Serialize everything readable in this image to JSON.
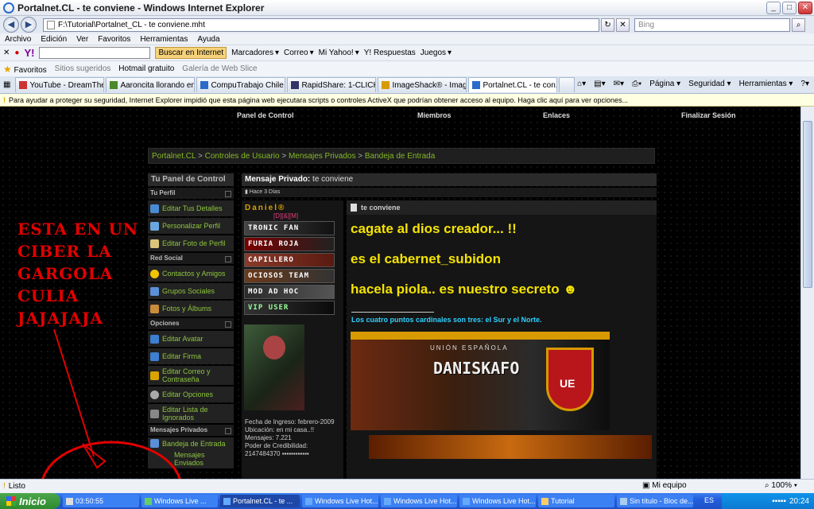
{
  "window": {
    "title": "Portalnet.CL - te conviene - Windows Internet Explorer"
  },
  "address": {
    "url": "F:\\Tutorial\\Portalnet_CL - te conviene.mht",
    "search_placeholder": "Bing"
  },
  "menu": [
    "Archivo",
    "Edición",
    "Ver",
    "Favoritos",
    "Herramientas",
    "Ayuda"
  ],
  "yahoo_toolbar": {
    "search_button": "Buscar en Internet",
    "items": [
      "Marcadores",
      "Correo",
      "Mi Yahoo!",
      "Y! Respuestas",
      "Juegos"
    ]
  },
  "favorites_bar": {
    "label": "Favoritos",
    "items": [
      "Sitios sugeridos",
      "Hotmail gratuito",
      "Galería de Web Slice"
    ]
  },
  "tabs": [
    "YouTube - DreamTheate...",
    "Aaroncita llorando en el ...",
    "CompuTrabajo Chile - E...",
    "RapidShare: 1-CLICK W...",
    "ImageShack® - Image ...",
    "Portalnet.CL - te con..."
  ],
  "tab_tools": [
    "Página",
    "Seguridad",
    "Herramientas"
  ],
  "infobar": "Para ayudar a proteger su seguridad, Internet Explorer impidió que esta página web ejecutara scripts o controles ActiveX que podrían obtener acceso al equipo. Haga clic aquí para ver opciones...",
  "site": {
    "topnav": [
      "Panel de Control",
      "Miembros",
      "Enlaces",
      "Finalizar Sesión"
    ],
    "breadcrumb": [
      "Portalnet.CL",
      "Controles de Usuario",
      "Mensajes Privados",
      "Bandeja de Entrada"
    ],
    "panel_title": "Tu Panel de Control",
    "sections": {
      "perfil": "Tu Perfil",
      "social": "Red Social",
      "opciones": "Opciones",
      "mp": "Mensajes Privados"
    },
    "items": {
      "editar_detalles": "Editar Tus Detalles",
      "personalizar": "Personalizar Perfil",
      "foto": "Editar Foto de Perfil",
      "contactos": "Contactos y Amigos",
      "grupos": "Grupos Sociales",
      "fotos": "Fotos y Álbums",
      "avatar": "Editar Avatar",
      "firma": "Editar Firma",
      "correo": "Editar Correo y Contraseña",
      "opciones": "Editar Opciones",
      "ignorados": "Editar Lista de Ignorados",
      "bandeja": "Bandeja de Entrada",
      "enviados": "Mensajes Enviados"
    },
    "message": {
      "label": "Mensaje Privado:",
      "subject": "te conviene",
      "date": "Hace 3 Días",
      "post_title": "te conviene",
      "lines": [
        "cagate al dios creador... !!",
        "es el cabernet_subidon",
        "hacela piola.. es nuestro secreto ☻"
      ],
      "signature": "Los cuatro puntos cardinales son tres: el Sur y el Norte.",
      "banner_top": "UNIÓN ESPAÑOLA",
      "banner_main": "DANISKAFO",
      "banner_crest": "UE"
    },
    "user": {
      "name": "Daniel®",
      "tag": "[D][&][M]",
      "badges": [
        "TRONIC FAN",
        "FURIA ROJA",
        "CAPILLERO",
        "OCIOSOS TEAM",
        "MOD AD HOC",
        "VIP USER"
      ],
      "info": {
        "ingreso": "Fecha de Ingreso: febrero-2009",
        "ubicacion": "Ubicación: en mi casa..!!",
        "mensajes": "Mensajes: 7.221",
        "poder": "Poder de Credibilidad: 2147484370 ▪▪▪▪▪▪▪▪▪▪▪▪"
      }
    }
  },
  "overlay_text": [
    "ESTA EN UN",
    "CIBER LA",
    "GARGOLA",
    "CULIA",
    "JAJAJAJA"
  ],
  "status": {
    "text": "Listo",
    "zone": "Mi equipo",
    "zoom": "100%"
  },
  "taskbar": {
    "start": "Inicio",
    "tasks": [
      "03:50:55",
      "Windows Live ...",
      "Portalnet.CL - te ...",
      "Windows Live Hot...",
      "Windows Live Hot...",
      "Windows Live Hot...",
      "Tutorial",
      "Sin título - Bloc de..."
    ],
    "lang": "ES",
    "clock": "20:24"
  }
}
